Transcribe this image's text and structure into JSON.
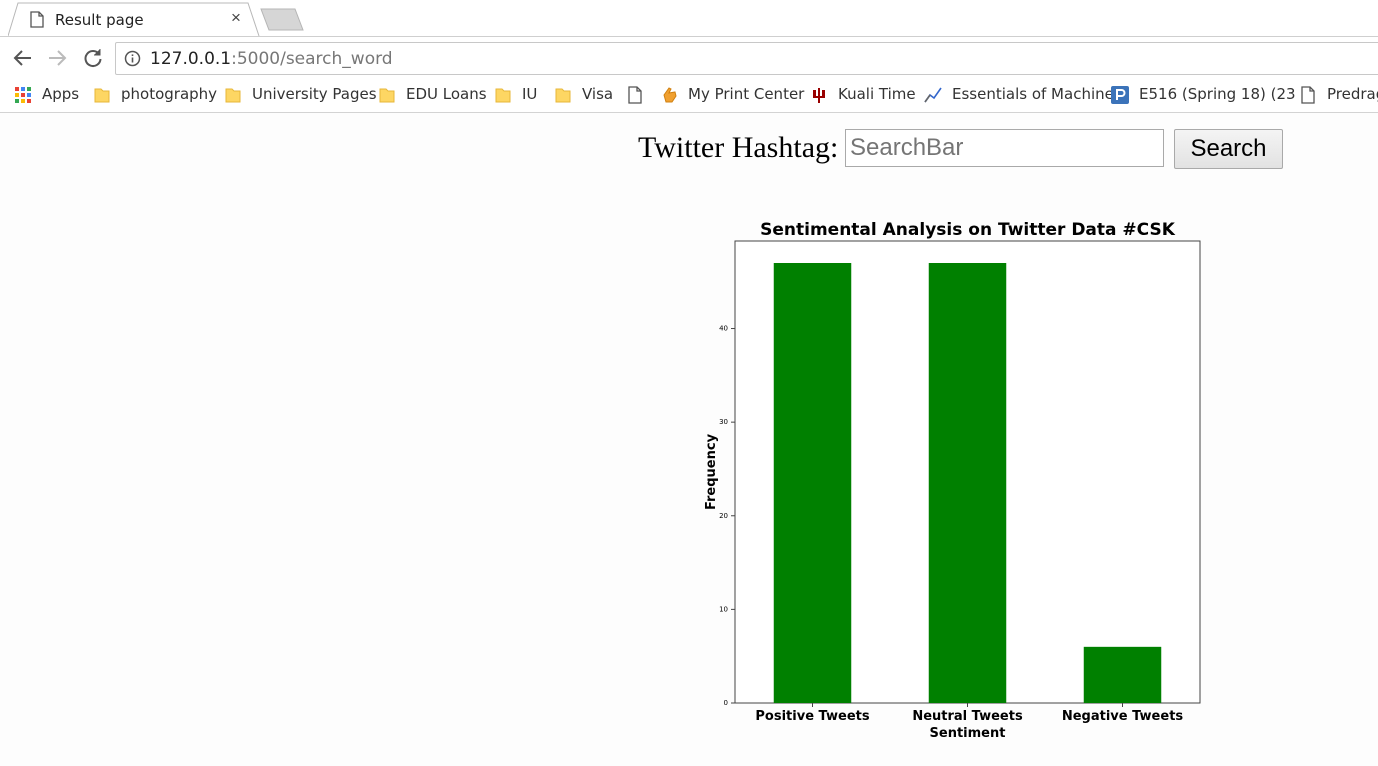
{
  "browser": {
    "tab_title": "Result page",
    "tab_close": "×",
    "url_host": "127.0.0.1",
    "url_rest": ":5000/search_word",
    "bookmarks": [
      {
        "label": "Apps",
        "icon": "apps-grid-icon"
      },
      {
        "label": "photography",
        "icon": "folder-icon"
      },
      {
        "label": "University Pages",
        "icon": "folder-icon"
      },
      {
        "label": "EDU Loans",
        "icon": "folder-icon"
      },
      {
        "label": "IU",
        "icon": "folder-icon"
      },
      {
        "label": "Visa",
        "icon": "folder-icon"
      },
      {
        "label": "",
        "icon": "page-icon"
      },
      {
        "label": "My Print Center",
        "icon": "hand-icon"
      },
      {
        "label": "Kuali Time",
        "icon": "iu-trident-icon"
      },
      {
        "label": "Essentials of Machine",
        "icon": "chart-line-icon"
      },
      {
        "label": "E516 (Spring 18) (23",
        "icon": "p-logo-icon"
      },
      {
        "label": "Predrag",
        "icon": "page-icon"
      }
    ]
  },
  "page": {
    "search_label": "Twitter Hashtag:",
    "search_placeholder": "SearchBar",
    "search_button": "Search"
  },
  "chart_data": {
    "type": "bar",
    "title": "Sentimental Analysis on Twitter Data #CSK",
    "xlabel": "Sentiment",
    "ylabel": "Frequency",
    "categories": [
      "Positive Tweets",
      "Neutral Tweets",
      "Negative Tweets"
    ],
    "values": [
      47,
      47,
      6
    ],
    "ylim": [
      0,
      49.35
    ],
    "yticks": [
      0,
      10,
      20,
      30,
      40
    ],
    "bar_color": "#008000",
    "grid": false
  }
}
